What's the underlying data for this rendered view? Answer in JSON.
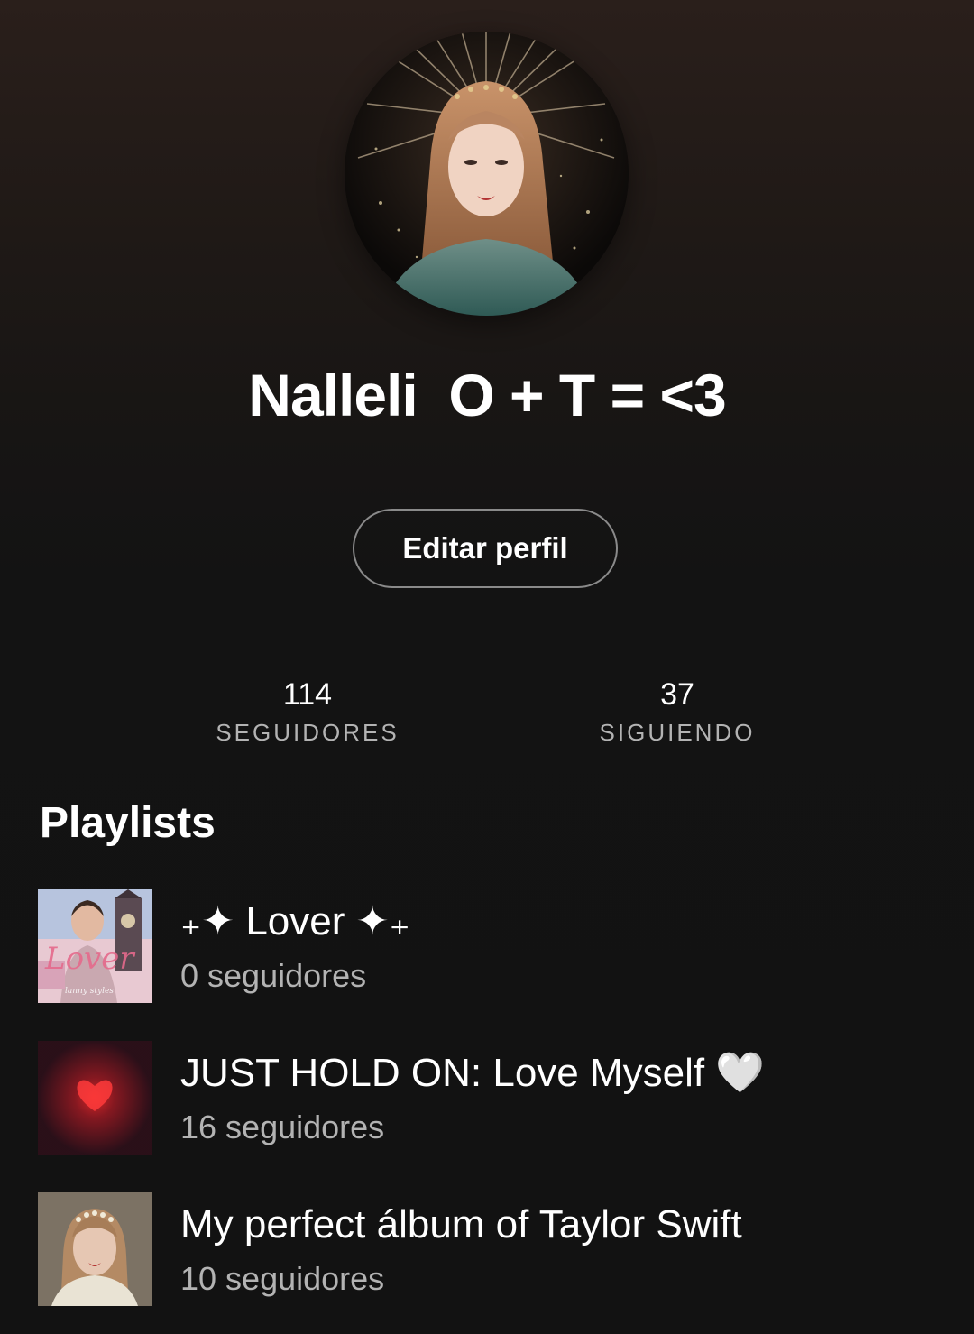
{
  "profile": {
    "name": "Nalleli  O + T = <3",
    "edit_button_label": "Editar perfil"
  },
  "stats": {
    "followers": {
      "count": "114",
      "label": "SEGUIDORES"
    },
    "following": {
      "count": "37",
      "label": "SIGUIENDO"
    }
  },
  "playlists": {
    "section_title": "Playlists",
    "items": [
      {
        "title": "₊✦ Lover ✦₊",
        "followers": "0 seguidores",
        "cover_icon": "lover-cover-art"
      },
      {
        "title": "JUST HOLD ON: Love Myself 🤍",
        "followers": "16 seguidores",
        "cover_icon": "red-heart-cover-art"
      },
      {
        "title": "My perfect álbum of Taylor Swift",
        "followers": "10 seguidores",
        "cover_icon": "portrait-cover-art"
      }
    ]
  },
  "colors": {
    "background": "#121212",
    "header_gradient_top": "#2a1f1b",
    "text_primary": "#ffffff",
    "text_secondary": "#b3b3b3",
    "button_border": "#8a8a8a"
  }
}
